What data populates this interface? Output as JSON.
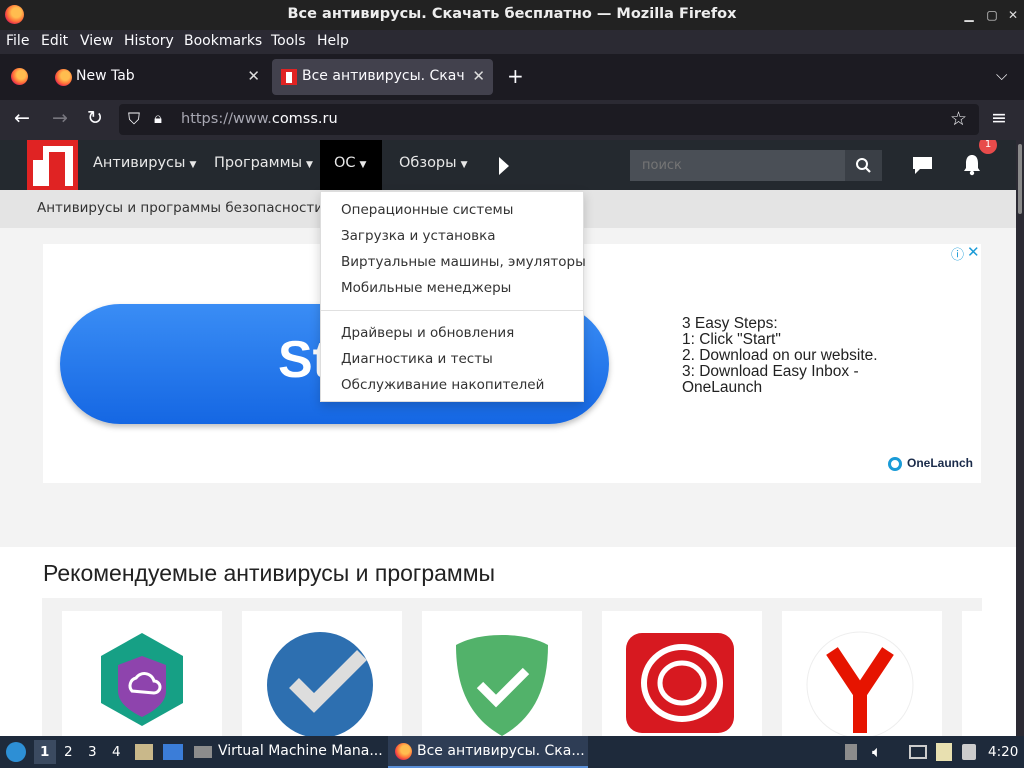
{
  "window": {
    "title": "Все антивирусы. Скачать бесплатно — Mozilla Firefox"
  },
  "menubar": [
    "File",
    "Edit",
    "View",
    "History",
    "Bookmarks",
    "Tools",
    "Help"
  ],
  "tabs": [
    {
      "label": "New Tab",
      "active": false
    },
    {
      "label": "Все антивирусы. Скача",
      "active": true
    }
  ],
  "urlbar": {
    "scheme": "https://www.",
    "domain": "comss.ru"
  },
  "site": {
    "nav": [
      {
        "label": "Антивирусы"
      },
      {
        "label": "Программы"
      },
      {
        "label": "ОС"
      },
      {
        "label": "Обзоры"
      }
    ],
    "search_placeholder": "поиск",
    "notification_count": "1",
    "subtitle": "Антивирусы и программы безопасности",
    "dropdown": {
      "group1": [
        "Операционные системы",
        "Загрузка и установка",
        "Виртуальные машины, эмуляторы",
        "Мобильные менеджеры"
      ],
      "group2": [
        "Драйверы и обновления",
        "Диагностика и тесты",
        "Обслуживание накопителей"
      ]
    },
    "ad": {
      "button_text": "St",
      "steps": "3 Easy Steps:\n1: Click \"Start\"\n2. Download on our website.\n3: Download Easy Inbox -\nOneLaunch",
      "brand": "OneLaunch"
    },
    "recommended_title": "Рекомендуемые антивирусы и программы"
  },
  "taskbar": {
    "workspaces": [
      "1",
      "2",
      "3",
      "4"
    ],
    "tasks": [
      "Virtual Machine Mana...",
      "Все антивирусы. Ска..."
    ],
    "clock": "4:20"
  },
  "colors": {
    "accent_red": "#e02323",
    "site_nav_bg": "#24292f",
    "ad_blue": "#1567e3"
  }
}
